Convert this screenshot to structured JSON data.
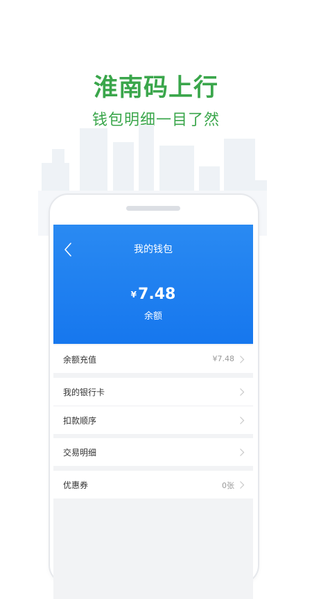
{
  "promo": {
    "title": "淮南码上行",
    "subtitle": "钱包明细一目了然"
  },
  "colors": {
    "brand_green": "#3aa64b",
    "header_blue": "#1a7df0",
    "section_gray": "#f2f3f5"
  },
  "wallet": {
    "title": "我的钱包",
    "currency_symbol": "¥",
    "balance": "7.48",
    "balance_label": "余额"
  },
  "menu": {
    "recharge": {
      "label": "余额充值",
      "value": "¥7.48"
    },
    "bank_card": {
      "label": "我的银行卡"
    },
    "deduction_order": {
      "label": "扣款顺序"
    },
    "transactions": {
      "label": "交易明细"
    },
    "coupons": {
      "label": "优惠券",
      "value": "0张"
    }
  },
  "icons": {
    "back": "back-chevron-icon",
    "row_arrow": "chevron-right-icon"
  }
}
